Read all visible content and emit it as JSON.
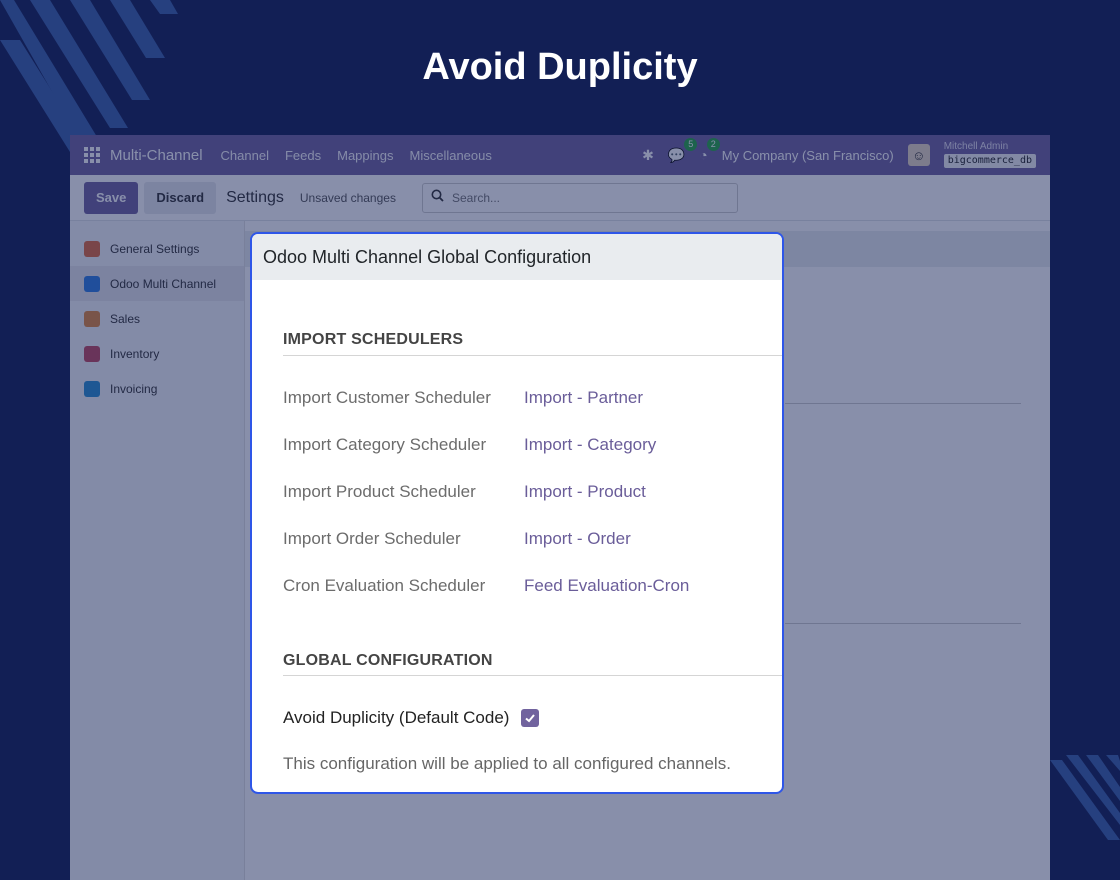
{
  "hero": {
    "title": "Avoid Duplicity"
  },
  "navbar": {
    "app_name": "Multi-Channel",
    "menu": [
      "Channel",
      "Feeds",
      "Mappings",
      "Miscellaneous"
    ],
    "messages_count": "5",
    "activities_count": "2",
    "company": "My Company (San Francisco)",
    "user_name": "Mitchell Admin",
    "database": "bigcommerce_db"
  },
  "control_panel": {
    "save_label": "Save",
    "discard_label": "Discard",
    "title": "Settings",
    "status": "Unsaved changes",
    "search_placeholder": "Search..."
  },
  "sidebar": {
    "items": [
      {
        "label": "General Settings",
        "icon": "settings-cog-icon",
        "color": "#e06a3c"
      },
      {
        "label": "Odoo Multi Channel",
        "icon": "multichannel-icon",
        "color": "#2f7de1"
      },
      {
        "label": "Sales",
        "icon": "sales-chart-icon",
        "color": "#e0883c"
      },
      {
        "label": "Inventory",
        "icon": "inventory-box-icon",
        "color": "#c0485f"
      },
      {
        "label": "Invoicing",
        "icon": "invoicing-icon",
        "color": "#2b8fd1"
      }
    ]
  },
  "dialog": {
    "title": "Odoo Multi Channel Global Configuration",
    "import_section": "IMPORT SCHEDULERS",
    "schedulers": [
      {
        "label": "Import Customer Scheduler",
        "value": "Import - Partner"
      },
      {
        "label": "Import Category Scheduler",
        "value": "Import - Category"
      },
      {
        "label": "Import Product Scheduler",
        "value": "Import - Product"
      },
      {
        "label": "Import Order Scheduler",
        "value": "Import - Order"
      },
      {
        "label": "Cron Evaluation Scheduler",
        "value": "Feed Evaluation-Cron"
      }
    ],
    "global_section": "GLOBAL CONFIGURATION",
    "avoid_duplicity_label": "Avoid Duplicity (Default Code)",
    "avoid_duplicity_checked": true,
    "help_text": "This configuration will be applied to all configured channels."
  },
  "colors": {
    "background": "#121f55",
    "navbar": "#71639e",
    "dialog_border": "#2e56e8",
    "link": "#6a5d99"
  }
}
